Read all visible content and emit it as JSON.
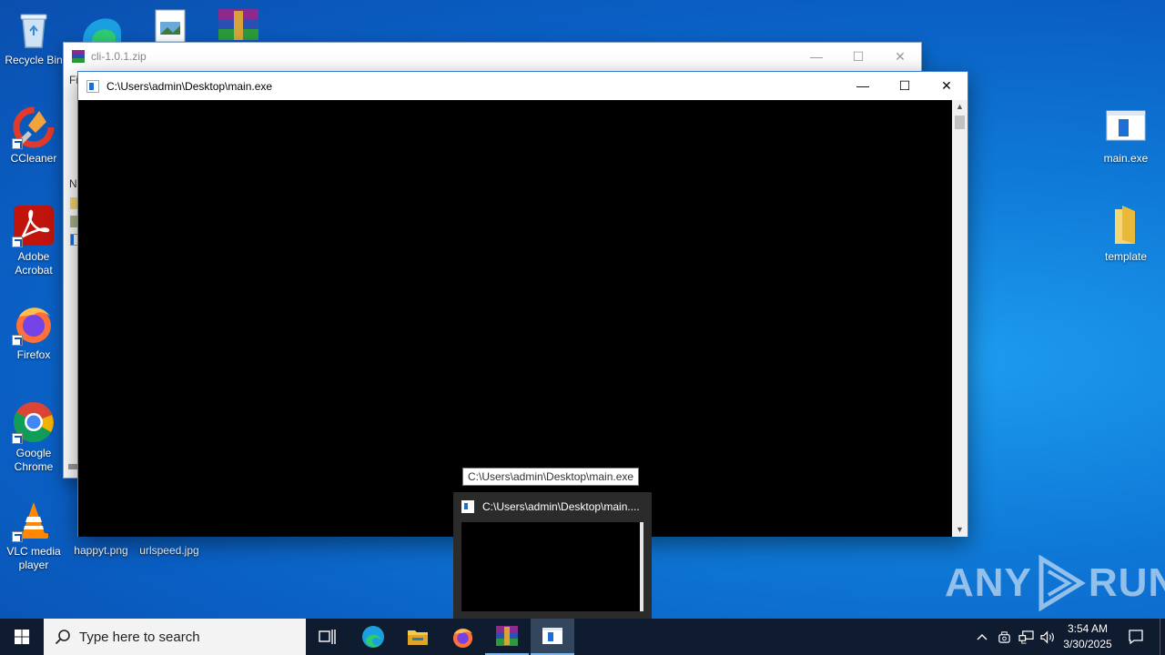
{
  "desktop": {
    "icons_left": [
      {
        "label": "Recycle Bin"
      },
      {
        "label": "CCleaner"
      },
      {
        "label": "Adobe Acrobat"
      },
      {
        "label": "Firefox"
      },
      {
        "label": "Google Chrome"
      },
      {
        "label": "VLC media player"
      }
    ],
    "icons_bottom": [
      {
        "label": "happyt.png"
      },
      {
        "label": "urlspeed.jpg"
      }
    ],
    "icons_right": [
      {
        "label": "main.exe"
      },
      {
        "label": "template"
      }
    ]
  },
  "winrar_window": {
    "title": "cli-1.0.1.zip",
    "menu_fragment": "Fi",
    "column_fragment": "N"
  },
  "console_window": {
    "title": "C:\\Users\\admin\\Desktop\\main.exe"
  },
  "taskbar_preview": {
    "tooltip": "C:\\Users\\admin\\Desktop\\main.exe",
    "title": "C:\\Users\\admin\\Desktop\\main...."
  },
  "watermark": {
    "left": "ANY",
    "right": "RUN"
  },
  "taskbar": {
    "search_placeholder": "Type here to search",
    "time": "3:54 AM",
    "date": "3/30/2025"
  },
  "colors": {
    "accent": "#0a5fc4",
    "taskbar": "#0f1b2e",
    "console_bg": "#000000"
  }
}
